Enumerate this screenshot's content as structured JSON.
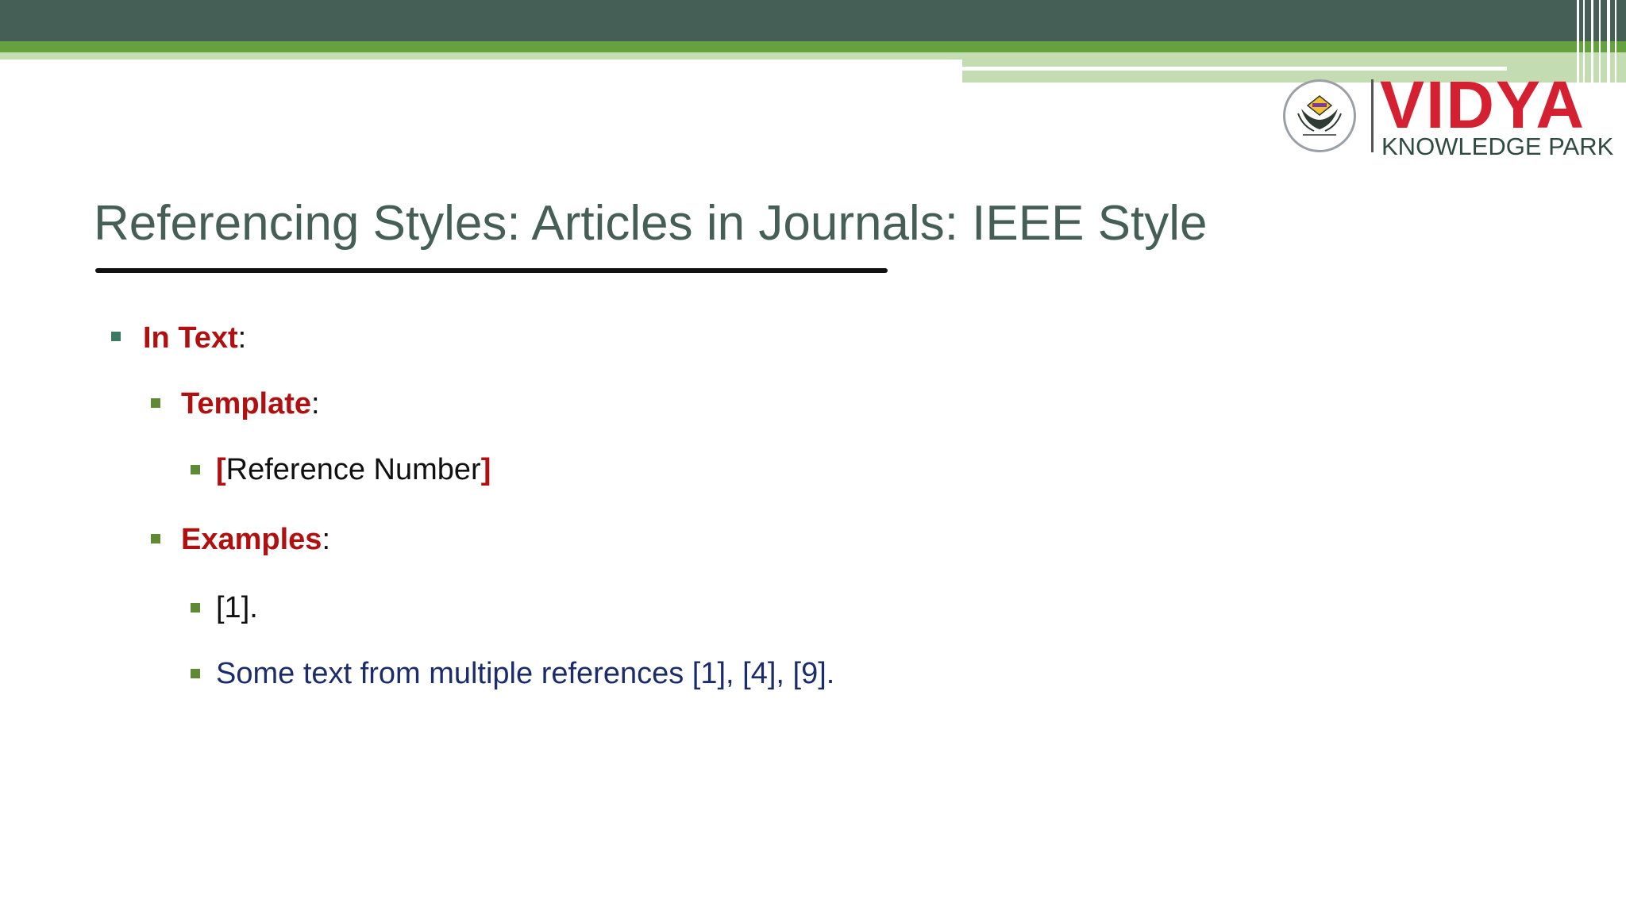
{
  "slide": {
    "title": "Referencing Styles: Articles in Journals: IEEE Style",
    "logo": {
      "name": "VIDYA",
      "subtitle": "KNOWLEDGE PARK"
    },
    "bullets": [
      {
        "level": 1,
        "label": "In Text",
        "suffix": ":"
      },
      {
        "level": 2,
        "label": "Template",
        "suffix": ":"
      },
      {
        "level": 3,
        "open": "[",
        "text": "Reference Number",
        "close": "]"
      },
      {
        "level": 2,
        "label": "Examples",
        "suffix": ":"
      },
      {
        "level": 3,
        "text": "[1]."
      },
      {
        "level": 3,
        "text": "Some text from multiple references [1], [4], [9]."
      }
    ],
    "colors": {
      "header_dark": "#455f56",
      "header_green": "#64a23e",
      "header_light": "#c4dcb2",
      "label_red": "#b01010",
      "example_navy": "#1a2c6b",
      "logo_red": "#d42030"
    }
  }
}
